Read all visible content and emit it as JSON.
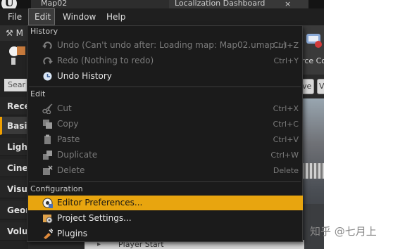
{
  "window": {
    "logo": "ue-logo",
    "tabs": [
      {
        "label": "Map02"
      },
      {
        "label": "Localization Dashboard"
      }
    ],
    "tab_close": "×"
  },
  "menubar": {
    "items": [
      {
        "label": "File"
      },
      {
        "label": "Edit",
        "active": true
      },
      {
        "label": "Window"
      },
      {
        "label": "Help"
      }
    ]
  },
  "modes_panel": {
    "mode_label": "M",
    "search_placeholder": "Sear",
    "categories": [
      {
        "label": "Rece"
      },
      {
        "label": "Basic",
        "selected": true
      },
      {
        "label": "Light"
      },
      {
        "label": "Ciner"
      },
      {
        "label": "Visua"
      },
      {
        "label": "Geon"
      },
      {
        "label": "Volur"
      }
    ]
  },
  "toolbar": {
    "content_label": "rce Co",
    "viewport_button_1": "ve",
    "viewport_button_2": "V"
  },
  "outliner": {
    "row_label": "Player Start"
  },
  "edit_menu": {
    "sections": {
      "history": "History",
      "edit": "Edit",
      "configuration": "Configuration"
    },
    "items": {
      "undo": {
        "label": "Undo (Can't undo after: Loading map: Map02.umap...)",
        "shortcut": "Ctrl+Z",
        "icon": "undo-icon"
      },
      "redo": {
        "label": "Redo (Nothing to redo)",
        "shortcut": "Ctrl+Y",
        "icon": "redo-icon"
      },
      "undo_history": {
        "label": "Undo History",
        "shortcut": "",
        "icon": "history-icon"
      },
      "cut": {
        "label": "Cut",
        "shortcut": "Ctrl+X",
        "icon": "scissors-icon"
      },
      "copy": {
        "label": "Copy",
        "shortcut": "Ctrl+C",
        "icon": "copy-icon"
      },
      "paste": {
        "label": "Paste",
        "shortcut": "Ctrl+V",
        "icon": "paste-icon"
      },
      "duplicate": {
        "label": "Duplicate",
        "shortcut": "Ctrl+W",
        "icon": "duplicate-icon"
      },
      "delete": {
        "label": "Delete",
        "shortcut": "Delete",
        "icon": "delete-icon"
      },
      "editor_preferences": {
        "label": "Editor Preferences...",
        "shortcut": "",
        "icon": "editor-preferences-icon",
        "highlighted": true
      },
      "project_settings": {
        "label": "Project Settings...",
        "shortcut": "",
        "icon": "project-settings-icon"
      },
      "plugins": {
        "label": "Plugins",
        "shortcut": "",
        "icon": "plugins-icon"
      }
    }
  },
  "watermark": "知乎 @七月上",
  "colors": {
    "highlight": "#e8a50f",
    "menu_bg": "#1b1b1b",
    "selected_category_accent": "#f0a000"
  }
}
